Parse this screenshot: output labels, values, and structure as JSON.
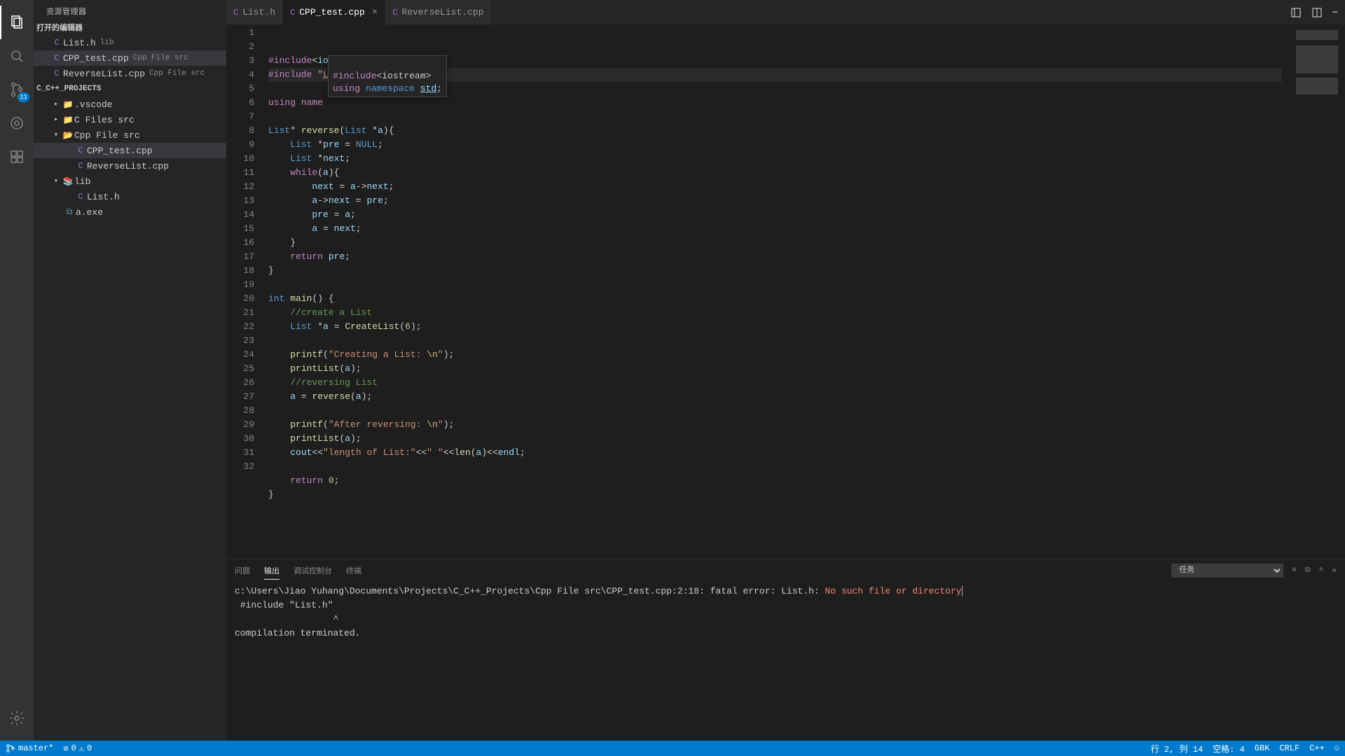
{
  "sidebar": {
    "title": "资源管理器",
    "open_editors_label": "打开的编辑器",
    "workspace_label": "C_C++_PROJECTS",
    "open_editors": [
      {
        "name": "List.h",
        "hint": "lib",
        "icon_class": "cpp"
      },
      {
        "name": "CPP_test.cpp",
        "hint": "Cpp File src",
        "icon_class": "cpp",
        "active": true
      },
      {
        "name": "ReverseList.cpp",
        "hint": "Cpp File src",
        "icon_class": "cpp"
      }
    ],
    "tree": {
      "vscode": ".vscode",
      "cfiles": "C Files src",
      "cppfiles": "Cpp File src",
      "cpp_children": [
        {
          "name": "CPP_test.cpp",
          "active": true
        },
        {
          "name": "ReverseList.cpp"
        }
      ],
      "lib": "lib",
      "lib_children": [
        {
          "name": "List.h"
        }
      ],
      "aexe": "a.exe"
    }
  },
  "tabs": [
    {
      "label": "List.h",
      "icon_color": "#a074c4"
    },
    {
      "label": "CPP_test.cpp",
      "icon_color": "#a074c4",
      "active": true,
      "closable": true
    },
    {
      "label": "ReverseList.cpp",
      "icon_color": "#a074c4"
    }
  ],
  "hover": {
    "line1_pre": "#include",
    "line1_rest": "<iostream>",
    "line2_using": "using",
    "line2_ns": "namespace",
    "line2_std": "std",
    "line2_semi": ";"
  },
  "code_lines": [
    {
      "n": 1,
      "html": "<span class='kw'>#include</span><span class='op'>&lt;</span><span class='id'>iostream</span><span class='op'>&gt;</span>"
    },
    {
      "n": 2,
      "hl": true,
      "html": "<span class='kw'>#include</span> <span class='str'>\"<span class='underline'>List</span>.h\"</span>"
    },
    {
      "n": 3,
      "html": ""
    },
    {
      "n": 4,
      "html": "<span class='kw'>using</span> <span class='kw'>name</span>"
    },
    {
      "n": 5,
      "html": ""
    },
    {
      "n": 6,
      "html": "<span class='type'>List</span><span class='op'>*</span> <span class='func'>reverse</span>(<span class='type'>List</span> <span class='op'>*</span><span class='id'>a</span>){"
    },
    {
      "n": 7,
      "html": "    <span class='type'>List</span> <span class='op'>*</span><span class='id'>pre</span> <span class='op'>=</span> <span class='const'>NULL</span>;"
    },
    {
      "n": 8,
      "html": "    <span class='type'>List</span> <span class='op'>*</span><span class='id'>next</span>;"
    },
    {
      "n": 9,
      "html": "    <span class='kw'>while</span>(<span class='id'>a</span>){"
    },
    {
      "n": 10,
      "html": "        <span class='id'>next</span> <span class='op'>=</span> <span class='id'>a</span><span class='op'>-&gt;</span><span class='id'>next</span>;"
    },
    {
      "n": 11,
      "html": "        <span class='id'>a</span><span class='op'>-&gt;</span><span class='id'>next</span> <span class='op'>=</span> <span class='id'>pre</span>;"
    },
    {
      "n": 12,
      "html": "        <span class='id'>pre</span> <span class='op'>=</span> <span class='id'>a</span>;"
    },
    {
      "n": 13,
      "html": "        <span class='id'>a</span> <span class='op'>=</span> <span class='id'>next</span>;"
    },
    {
      "n": 14,
      "html": "    }"
    },
    {
      "n": 15,
      "html": "    <span class='kw'>return</span> <span class='id'>pre</span>;"
    },
    {
      "n": 16,
      "html": "}"
    },
    {
      "n": 17,
      "html": ""
    },
    {
      "n": 18,
      "html": "<span class='type'>int</span> <span class='func'>main</span>() {"
    },
    {
      "n": 19,
      "html": "    <span class='comment'>//create a List</span>"
    },
    {
      "n": 20,
      "html": "    <span class='type'>List</span> <span class='op'>*</span><span class='id'>a</span> <span class='op'>=</span> <span class='func'>CreateList</span>(<span class='num'>6</span>);"
    },
    {
      "n": 21,
      "html": ""
    },
    {
      "n": 22,
      "html": "    <span class='func'>printf</span>(<span class='str'>\"Creating a List: <span class='str-esc'>\\n</span>\"</span>);"
    },
    {
      "n": 23,
      "html": "    <span class='func'>printList</span>(<span class='id'>a</span>);"
    },
    {
      "n": 24,
      "html": "    <span class='comment'>//reversing List</span>"
    },
    {
      "n": 25,
      "html": "    <span class='id'>a</span> <span class='op'>=</span> <span class='func'>reverse</span>(<span class='id'>a</span>);"
    },
    {
      "n": 26,
      "html": ""
    },
    {
      "n": 27,
      "html": "    <span class='func'>printf</span>(<span class='str'>\"After reversing: <span class='str-esc'>\\n</span>\"</span>);"
    },
    {
      "n": 28,
      "html": "    <span class='func'>printList</span>(<span class='id'>a</span>);"
    },
    {
      "n": 29,
      "html": "    <span class='id'>cout</span><span class='op'>&lt;&lt;</span><span class='str'>\"length of List:\"</span><span class='op'>&lt;&lt;</span><span class='str'>\" \"</span><span class='op'>&lt;&lt;</span><span class='func'>len</span>(<span class='id'>a</span>)<span class='op'>&lt;&lt;</span><span class='id'>endl</span>;"
    },
    {
      "n": 30,
      "html": ""
    },
    {
      "n": 31,
      "html": "    <span class='kw'>return</span> <span class='num'>0</span>;"
    },
    {
      "n": 32,
      "html": "}"
    }
  ],
  "panel": {
    "tabs": {
      "problems": "问题",
      "output": "输出",
      "debug": "调试控制台",
      "terminal": "终端"
    },
    "selector": "任务",
    "output_prefix": "c:\\Users\\Jiao Yuhang\\Documents\\Projects\\C_C++_Projects\\Cpp File src\\CPP_test.cpp:2:18: fatal error: List.h: ",
    "output_err": "No such file or directory",
    "output_line2": " #include \"List.h\"",
    "output_caret": "                  ^",
    "output_last": "compilation terminated."
  },
  "status": {
    "branch": "master*",
    "errors": "0",
    "warnings": "0",
    "cursor": "行 2, 列 14",
    "spaces": "空格: 4",
    "encoding": "GBK",
    "eol": "CRLF",
    "lang": "C++",
    "scm_badge": "11"
  }
}
